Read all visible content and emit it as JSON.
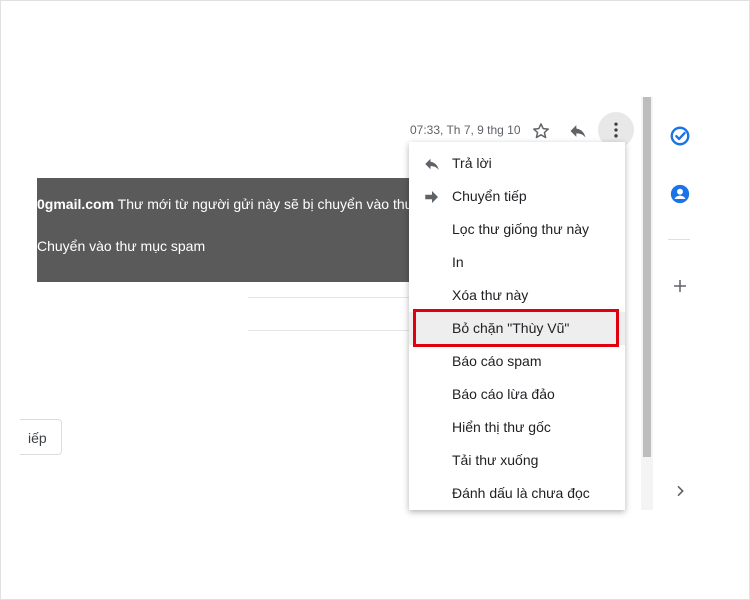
{
  "header": {
    "timestamp": "07:33, Th 7, 9 thg 10",
    "icons": [
      "star-icon",
      "reply-icon",
      "more-vert-icon"
    ]
  },
  "banner": {
    "email_fragment": "0gmail.com",
    "message": "Thư mới từ người gửi này sẽ bị chuyển vào thư mục",
    "action": "Chuyển vào thư mục spam"
  },
  "forward_button": {
    "label": "iếp"
  },
  "menu": {
    "items": [
      {
        "label": "Trả lời",
        "icon": "reply-icon"
      },
      {
        "label": "Chuyển tiếp",
        "icon": "forward-arrow-icon"
      },
      {
        "label": "Lọc thư giống thư này"
      },
      {
        "label": "In"
      },
      {
        "label": "Xóa thư này"
      },
      {
        "label": "Bỏ chặn \"Thùy Vũ\""
      },
      {
        "label": "Báo cáo spam"
      },
      {
        "label": "Báo cáo lừa đảo"
      },
      {
        "label": "Hiển thị thư gốc"
      },
      {
        "label": "Tải thư xuống"
      },
      {
        "label": "Đánh dấu là chưa đọc"
      }
    ],
    "highlight_color": "#e0000f"
  },
  "side_panel": {
    "icons": [
      "tasks-icon",
      "contacts-icon",
      "add-icon",
      "chevron-right-icon"
    ],
    "accent": "#1a73e8"
  }
}
